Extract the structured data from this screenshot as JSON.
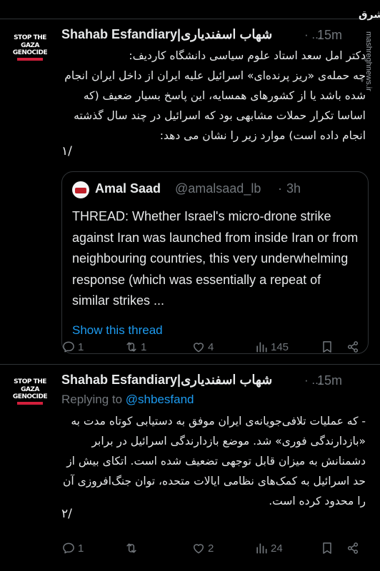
{
  "watermark": {
    "logo_text": "مشرق",
    "url": "mashreghnews.ir"
  },
  "tweets": [
    {
      "avatar": {
        "line1": "STOP THE",
        "line2": "GAZA",
        "line3": "GENOCIDE"
      },
      "display_name": "Shahab Esfandiary|شهاب اسفندیاری",
      "dot": "· ...",
      "time": "15m",
      "body": "دکتر امل سعد استاد علوم سیاسی دانشگاه کاردیف:\nچه حمله‌ی «ریز پرنده‌ای» اسرائیل علیه ایران از داخل ایران انجام شده باشد یا از کشورهای همسایه، این پاسخ بسیار ضعیف (که اساسا تکرار حملات مشابهی بود که اسرائیل در چند سال گذشته انجام داده است) موارد زیر را نشان می دهد:",
      "thread_marker": "۱/",
      "quote": {
        "name": "Amal Saad",
        "handle": "@amalsaad_lb",
        "sep": "·",
        "time": "3h",
        "text": "THREAD: Whether Israel's micro-drone strike against Iran was launched from inside Iran or from neighbouring countries, this very underwhelming response (which was essentially a repeat of similar strikes ...",
        "show_thread": "Show this thread"
      },
      "actions": {
        "replies": "1",
        "retweets": "1",
        "likes": "4",
        "views": "145"
      }
    },
    {
      "avatar": {
        "line1": "STOP THE",
        "line2": "GAZA",
        "line3": "GENOCIDE"
      },
      "display_name": "Shahab Esfandiary|شهاب اسفندیاری",
      "dot": "· ...",
      "time": "15m",
      "replying_prefix": "Replying to",
      "replying_handle": "@shbesfand",
      "body": "- که عملیات تلافی‌جویانه‌ی ایران موفق به دستیابی کوتاه مدت به «بازدارندگی فوری» شد. موضع بازدارندگی اسرائیل در برابر دشمنانش به میزان قابل توجهی تضعیف شده است. اتکای بیش از حد اسرائیل به کمک‌های نظامی ایالات متحده، توان جنگ‌افروزی آن را محدود کرده است.",
      "thread_marker": "۲/",
      "actions": {
        "replies": "1",
        "retweets": "",
        "likes": "2",
        "views": "24"
      }
    }
  ],
  "colors": {
    "background": "#000000",
    "text": "#e7e9ea",
    "muted": "#71767b",
    "link": "#1d9bf0",
    "divider": "#2f3336"
  },
  "icons": [
    "reply-icon",
    "retweet-icon",
    "like-icon",
    "views-icon",
    "bookmark-icon",
    "share-icon"
  ]
}
